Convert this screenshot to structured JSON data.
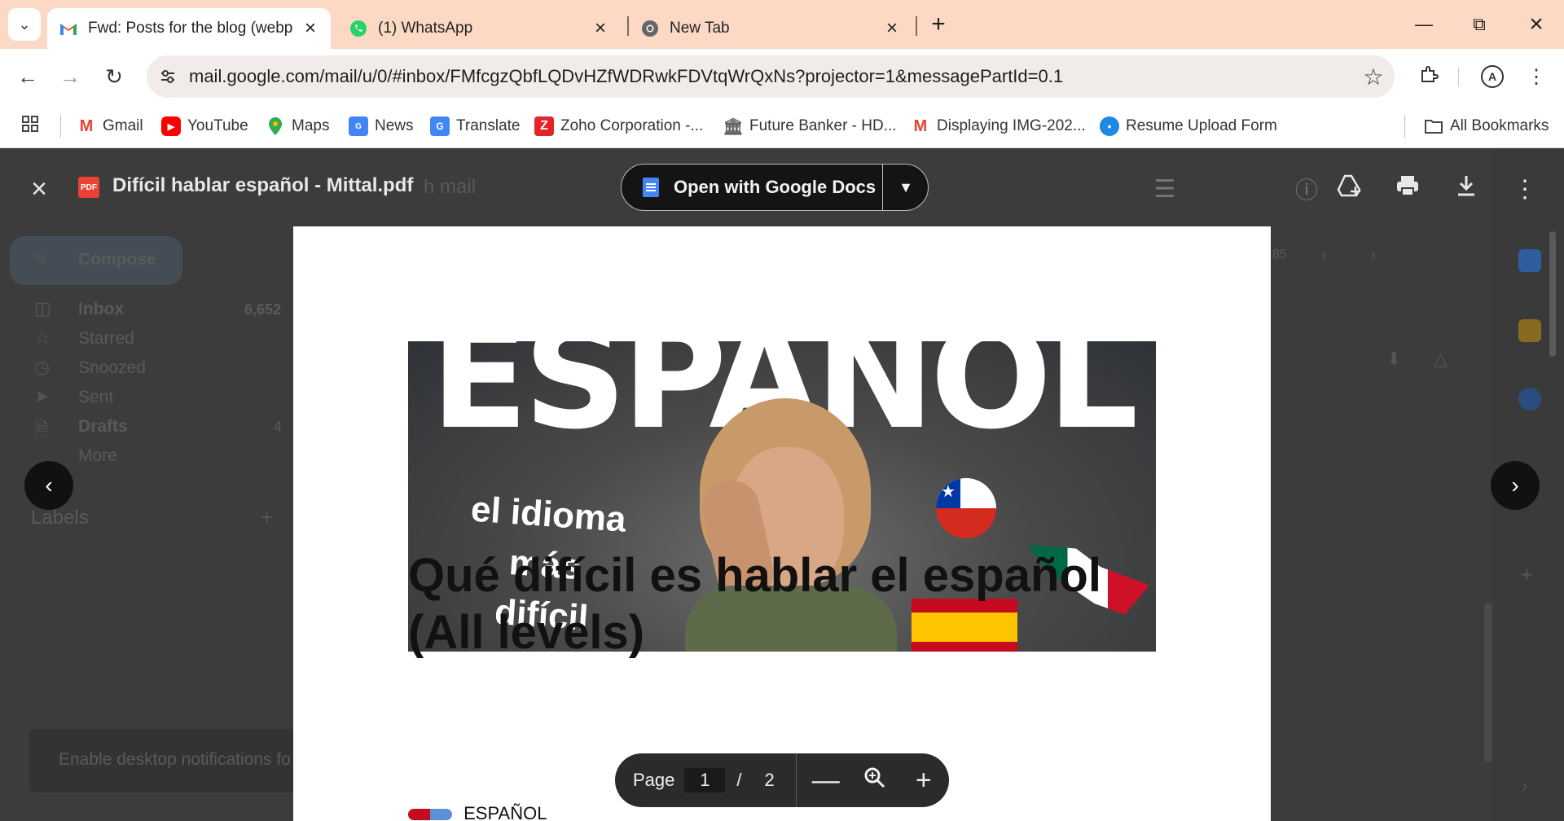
{
  "tabs": [
    {
      "title": "Fwd: Posts for the blog (webpag",
      "active": true,
      "icon": "gmail-icon"
    },
    {
      "title": "(1) WhatsApp",
      "active": false,
      "icon": "whatsapp-icon"
    },
    {
      "title": "New Tab",
      "active": false,
      "icon": "chrome-icon"
    }
  ],
  "address_bar": {
    "url": "mail.google.com/mail/u/0/#inbox/FMfcgzQbfLQDvHZfWDRwkFDVtqWrQxNs?projector=1&messagePartId=0.1"
  },
  "bookmarks": [
    {
      "label": "Gmail"
    },
    {
      "label": "YouTube"
    },
    {
      "label": "Maps"
    },
    {
      "label": "News"
    },
    {
      "label": "Translate"
    },
    {
      "label": "Zoho Corporation -..."
    },
    {
      "label": "Future Banker - HD..."
    },
    {
      "label": "Displaying IMG-202..."
    },
    {
      "label": "Resume Upload Form"
    },
    {
      "label": "All Bookmarks"
    }
  ],
  "gmail_background": {
    "compose": "Compose",
    "sidebar": [
      {
        "label": "Inbox",
        "count": "6,652"
      },
      {
        "label": "Starred",
        "count": ""
      },
      {
        "label": "Snoozed",
        "count": ""
      },
      {
        "label": "Sent",
        "count": ""
      },
      {
        "label": "Drafts",
        "count": "4"
      },
      {
        "label": "More",
        "count": ""
      }
    ],
    "labels_heading": "Labels",
    "notification": "Enable desktop notifications fo",
    "search_text": "h mail",
    "pagination": "85"
  },
  "viewer": {
    "file_title": "Difícil hablar español - Mittal.pdf",
    "open_with": "Open with Google Docs",
    "pdf_badge": "PDF"
  },
  "pdf": {
    "thumbnail_banner": "ESPANOL",
    "thumbnail_side_text": [
      "el idioma",
      "más",
      "difícil"
    ],
    "heading_line1": "Qué difícil es hablar el español",
    "heading_line2": "(All levels)",
    "sub_text": "ESPAÑOL"
  },
  "page_controls": {
    "page_label": "Page",
    "current_page": "1",
    "separator": "/",
    "total_pages": "2"
  }
}
